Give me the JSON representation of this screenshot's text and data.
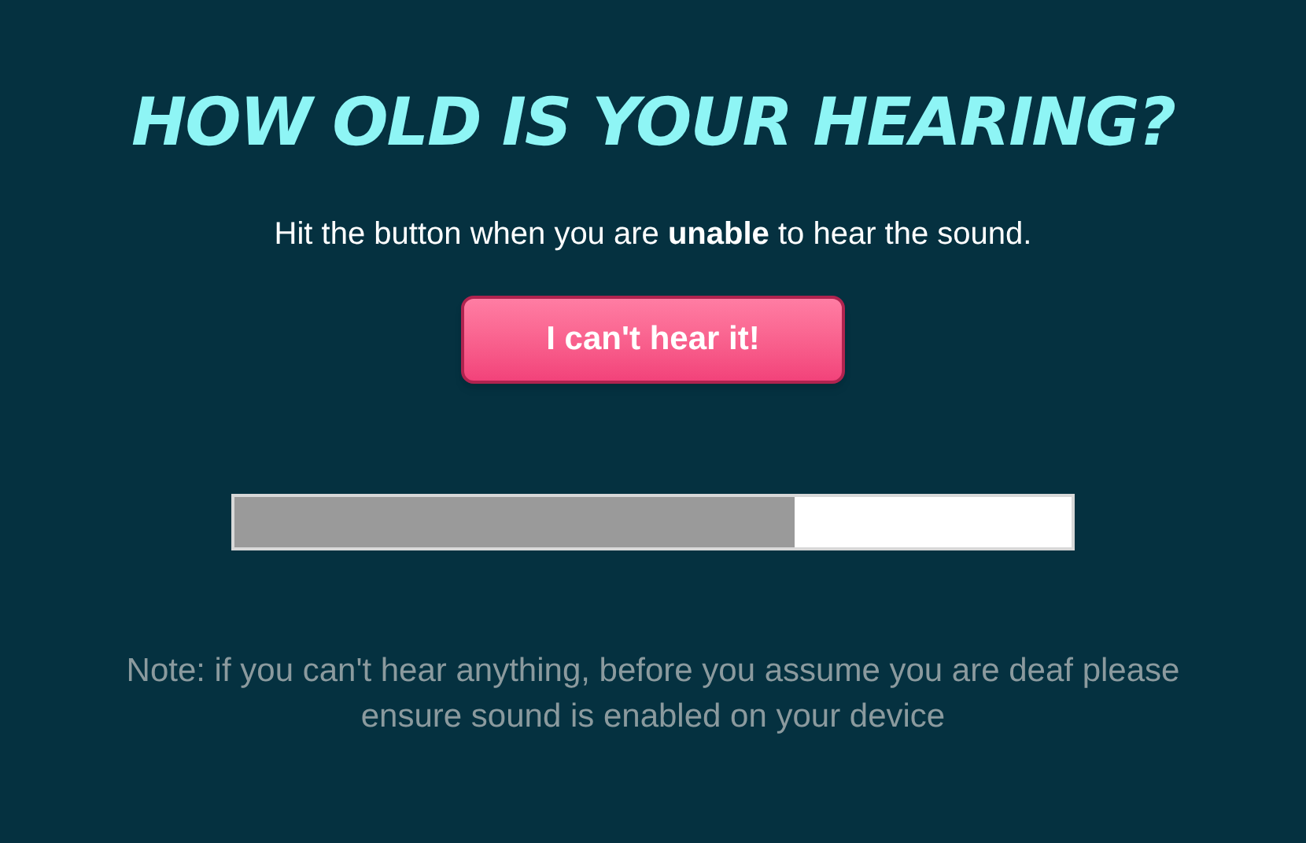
{
  "title": "HOW OLD IS YOUR HEARING?",
  "instruction": "Hit the button when you are **unable** to hear the sound.",
  "button": {
    "label": "I can't hear it!"
  },
  "progress": {
    "level": 0.67
  },
  "note": "Note: if you can't hear anything, before you assume you are deaf please ensure sound is enabled on your device"
}
